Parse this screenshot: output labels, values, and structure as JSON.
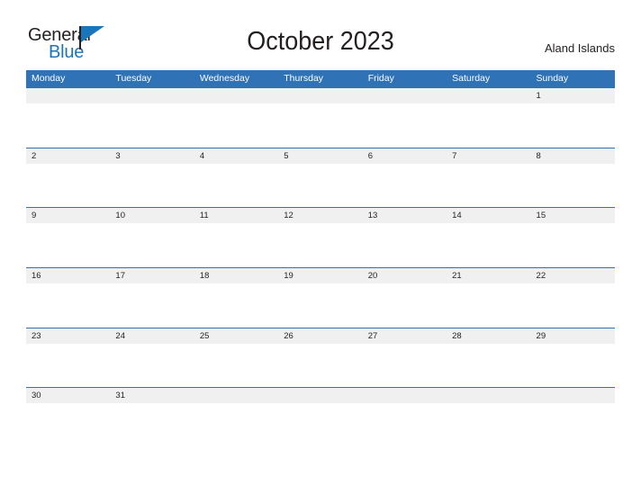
{
  "logo": {
    "word_one": "General",
    "word_two": "Blue",
    "flag_icon": "flag-icon",
    "brand_color": "#1b75bb",
    "text_color": "#231f20"
  },
  "header": {
    "title": "October 2023",
    "region": "Aland Islands"
  },
  "calendar": {
    "header_bg": "#2f72b5",
    "daynum_bg": "#f0f0f0",
    "rule_color": "#2f72b5",
    "weekdays": [
      "Monday",
      "Tuesday",
      "Wednesday",
      "Thursday",
      "Friday",
      "Saturday",
      "Sunday"
    ],
    "weeks": [
      [
        "",
        "",
        "",
        "",
        "",
        "",
        "1"
      ],
      [
        "2",
        "3",
        "4",
        "5",
        "6",
        "7",
        "8"
      ],
      [
        "9",
        "10",
        "11",
        "12",
        "13",
        "14",
        "15"
      ],
      [
        "16",
        "17",
        "18",
        "19",
        "20",
        "21",
        "22"
      ],
      [
        "23",
        "24",
        "25",
        "26",
        "27",
        "28",
        "29"
      ],
      [
        "30",
        "31",
        "",
        "",
        "",
        "",
        ""
      ]
    ]
  }
}
